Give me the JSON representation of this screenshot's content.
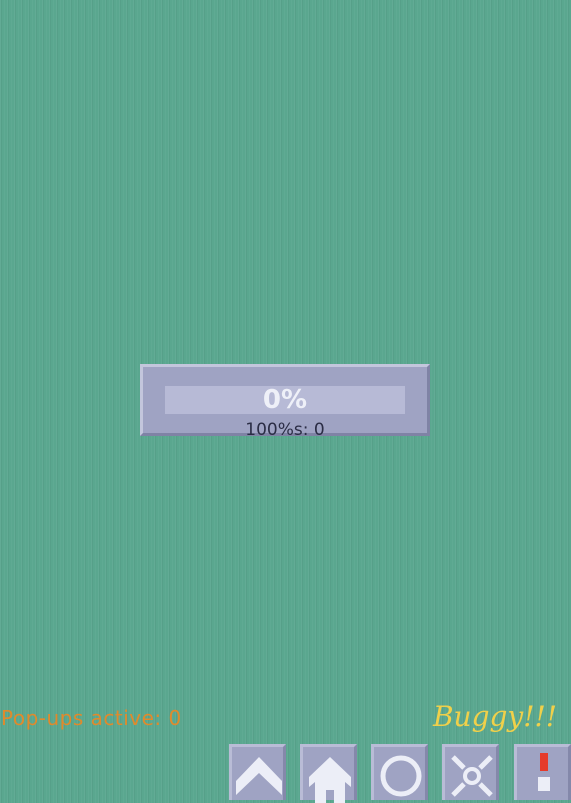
{
  "progress": {
    "percent_label": "0%",
    "fraction": 0,
    "hundreds_label": "100%s: 0"
  },
  "status": {
    "popups_label": "Pop-ups active: 0",
    "buggy_label": "Buggy!!!"
  },
  "toolbar": {
    "buttons": [
      {
        "icon": "chevron-up-icon"
      },
      {
        "icon": "home-icon"
      },
      {
        "icon": "circle-icon"
      },
      {
        "icon": "crosshair-icon"
      },
      {
        "icon": "warning-icon"
      }
    ]
  },
  "colors": {
    "background": "#5aa78f",
    "panel": "#9fa3c3",
    "popups_text": "#e08a2c",
    "buggy_text": "#f0d04a",
    "warning": "#e53b2c"
  }
}
